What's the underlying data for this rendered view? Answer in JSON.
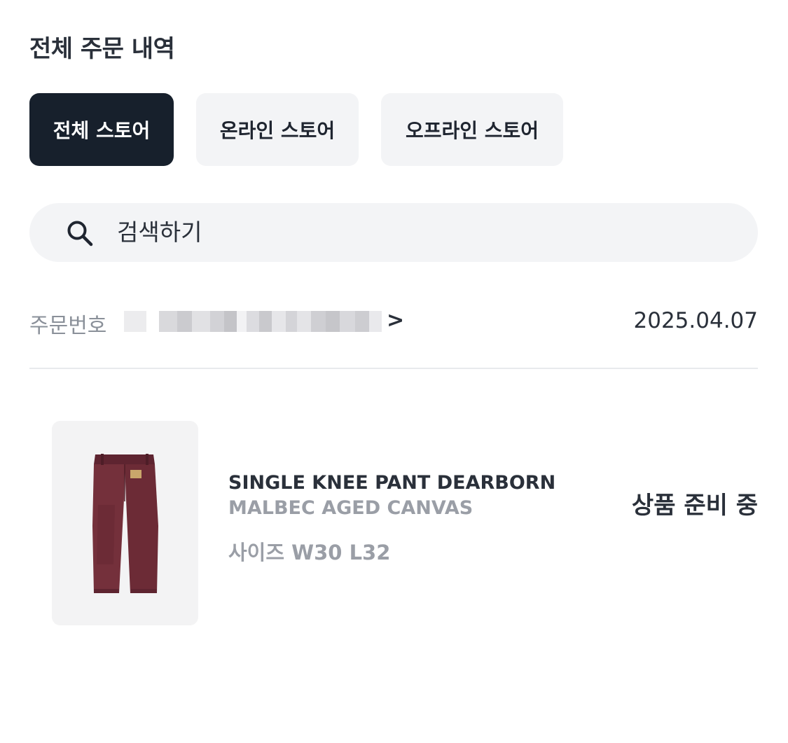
{
  "page": {
    "title": "전체 주문 내역"
  },
  "store_tabs": [
    {
      "label": "전체 스토어",
      "active": true
    },
    {
      "label": "온라인 스토어",
      "active": false
    },
    {
      "label": "오프라인 스토어",
      "active": false
    }
  ],
  "search": {
    "placeholder": "검색하기",
    "icon": "search-icon"
  },
  "order": {
    "number_label": "주문번호",
    "number_value_obscured": true,
    "chevron": ">",
    "date": "2025.04.07"
  },
  "item": {
    "name": "SINGLE KNEE PANT DEARBORN",
    "color": "MALBEC AGED CANVAS",
    "size": "사이즈 W30 L32",
    "status": "상품 준비 중",
    "image": "pants-image"
  },
  "colors": {
    "active_tab_bg": "#17202c",
    "inactive_tab_bg": "#f3f4f6",
    "product_color": "#6e2a34"
  }
}
